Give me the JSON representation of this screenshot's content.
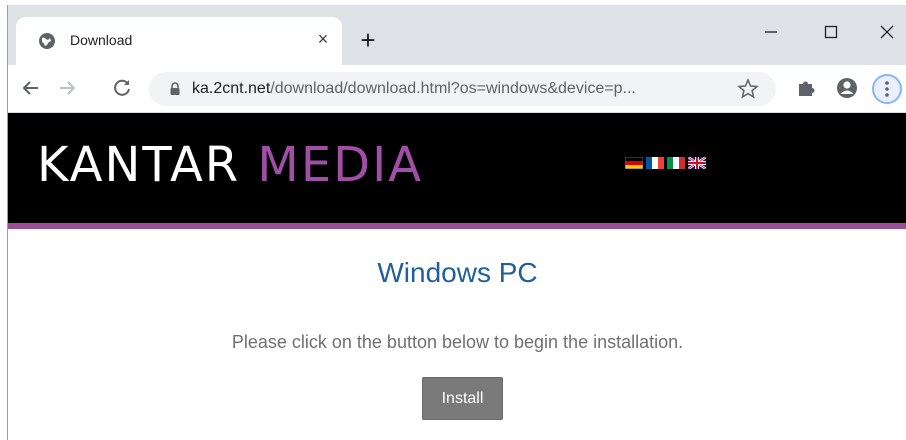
{
  "browser": {
    "tab": {
      "title": "Download",
      "favicon": "globe-icon",
      "close_label": "×"
    },
    "new_tab_label": "+",
    "window_controls": {
      "minimize": "minimize-icon",
      "maximize": "maximize-icon",
      "close": "close-icon"
    },
    "toolbar": {
      "back": "arrow-left-icon",
      "forward": "arrow-right-icon",
      "reload": "reload-icon",
      "url_host": "ka.2cnt.net",
      "url_rest": "/download/download.html?os=windows&device=p...",
      "bookmark": "star-icon",
      "extensions": "puzzle-icon",
      "profile": "account-icon",
      "menu": "more-vertical-icon"
    }
  },
  "site": {
    "logo_part1": "KANTAR",
    "logo_part2": "MEDIA",
    "flags": [
      "german-flag",
      "french-flag",
      "italian-flag",
      "uk-flag"
    ],
    "heading": "Windows PC",
    "instructions": "Please click on the button below to begin the installation.",
    "install_label": "Install"
  },
  "colors": {
    "header_bg": "#000000",
    "accent_purple": "#9b4f96",
    "heading_blue": "#1f5f9e",
    "button_gray": "#7a7a7a"
  }
}
